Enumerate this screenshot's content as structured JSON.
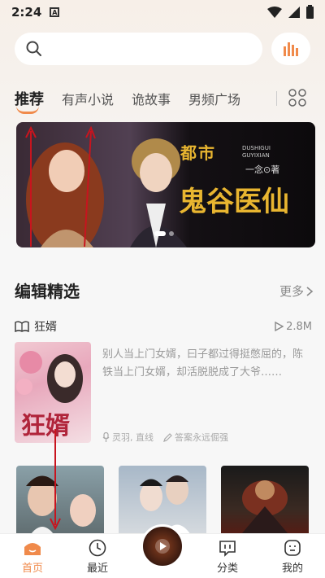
{
  "status_bar": {
    "time": "2:24",
    "notification_icon": "A"
  },
  "search": {
    "placeholder": ""
  },
  "tabs": [
    {
      "label": "推荐",
      "active": true
    },
    {
      "label": "有声小说"
    },
    {
      "label": "诡故事"
    },
    {
      "label": "男频广场"
    }
  ],
  "banner": {
    "title": "鬼谷医仙",
    "subtitle": "都市",
    "pinyin": "DUSHIGUI GUYIXIAN",
    "author": "一念⊙著"
  },
  "section": {
    "title": "编辑精选",
    "more_label": "更多"
  },
  "book": {
    "name": "狂婿",
    "plays": "2.8M",
    "cover_title": "狂婿",
    "description": "别人当上门女婿，曰子都过得挺憋屈的，陈铁当上门女婿，却活脱脱成了大爷……",
    "narrators": "灵羽, 直线",
    "author": "答案永远倔强"
  },
  "bottom_nav": [
    {
      "label": "首页",
      "active": true
    },
    {
      "label": "最近"
    },
    {
      "label": "分类"
    },
    {
      "label": "我的"
    }
  ],
  "colors": {
    "accent": "#f08a4b",
    "banner_title": "#e8b530",
    "annotation_arrow": "#c8141e"
  }
}
